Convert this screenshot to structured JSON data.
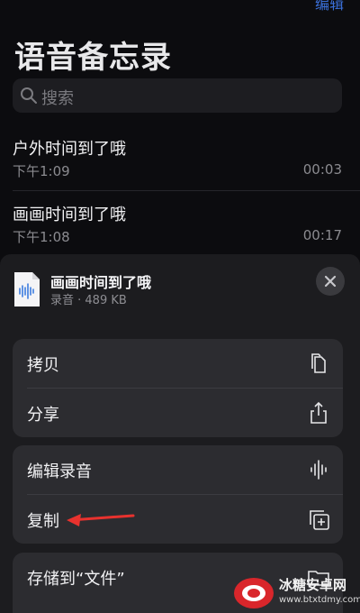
{
  "header": {
    "edit_label": "编辑",
    "title": "语音备忘录"
  },
  "search": {
    "placeholder": "搜索"
  },
  "recordings": [
    {
      "title": "户外时间到了哦",
      "time": "下午1:09",
      "duration": "00:03"
    },
    {
      "title": "画画时间到了哦",
      "time": "下午1:08",
      "duration": "00:17"
    }
  ],
  "share_sheet": {
    "file_name": "画画时间到了哦",
    "file_meta": "录音 · 489 KB",
    "actions_group1": [
      {
        "label": "拷贝",
        "icon": "copy-icon"
      },
      {
        "label": "分享",
        "icon": "share-icon"
      }
    ],
    "actions_group2": [
      {
        "label": "编辑录音",
        "icon": "waveform-icon"
      },
      {
        "label": "复制",
        "icon": "duplicate-icon"
      }
    ],
    "actions_group3": [
      {
        "label": "存储到“文件”",
        "icon": "folder-icon"
      }
    ]
  },
  "watermark": {
    "title": "冰糖安卓网",
    "url": "www.btxtdmy.com"
  },
  "colors": {
    "arrow": "#e8322e",
    "accent": "#3a6fd8"
  }
}
